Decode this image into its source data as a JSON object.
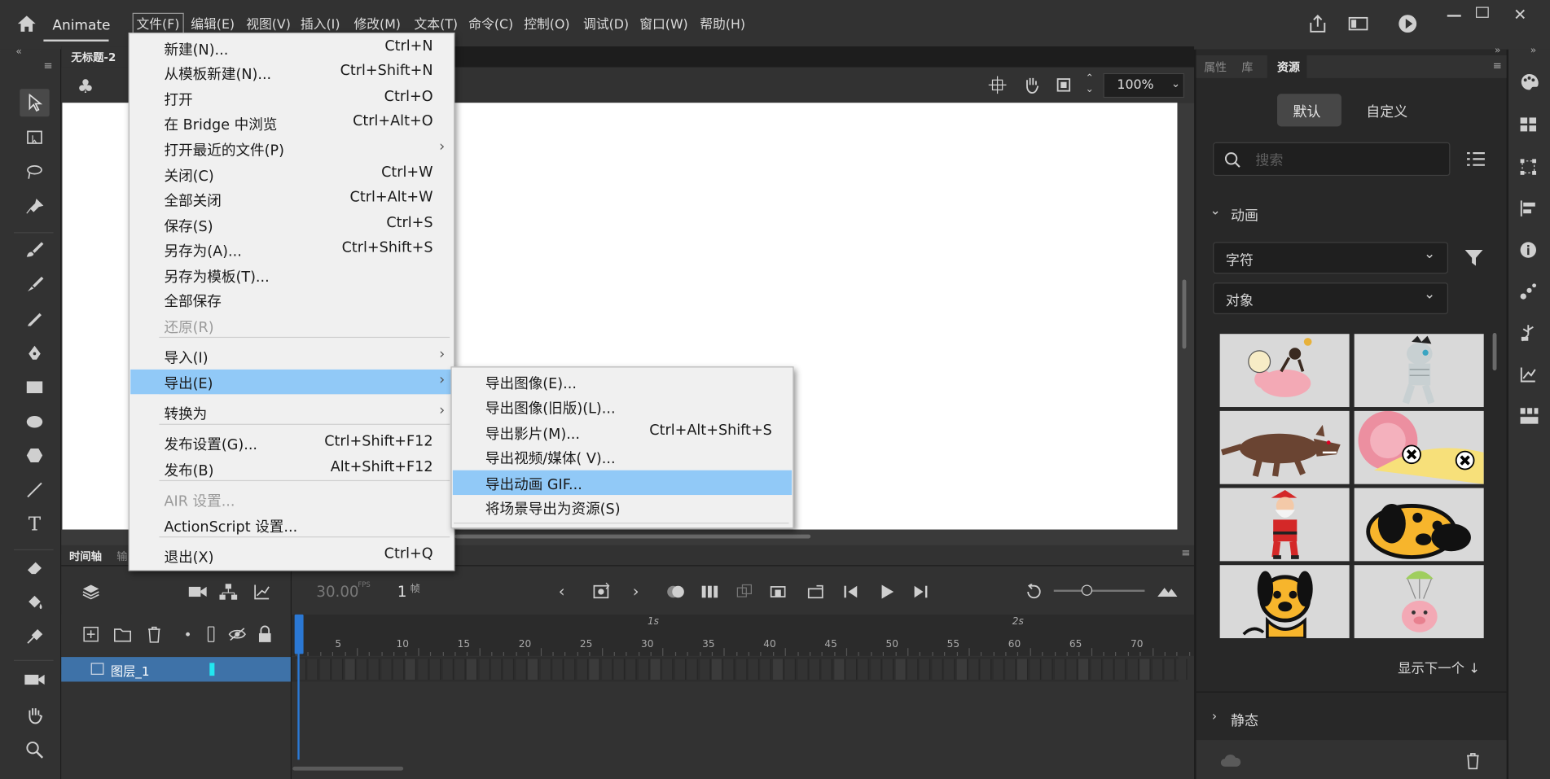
{
  "app": {
    "name": "Animate"
  },
  "menubar": [
    "文件(F)",
    "编辑(E)",
    "视图(V)",
    "插入(I)",
    "修改(M)",
    "文本(T)",
    "命令(C)",
    "控制(O)",
    "调试(D)",
    "窗口(W)",
    "帮助(H)"
  ],
  "document": {
    "tab": "无标题-2",
    "zoom": "100%"
  },
  "file_menu": [
    {
      "label": "新建(N)...",
      "shortcut": "Ctrl+N"
    },
    {
      "label": "从模板新建(N)...",
      "shortcut": "Ctrl+Shift+N"
    },
    {
      "label": "打开",
      "shortcut": "Ctrl+O"
    },
    {
      "label": "在 Bridge 中浏览",
      "shortcut": "Ctrl+Alt+O"
    },
    {
      "label": "打开最近的文件(P)",
      "shortcut": ""
    },
    {
      "label": "关闭(C)",
      "shortcut": "Ctrl+W"
    },
    {
      "label": "全部关闭",
      "shortcut": "Ctrl+Alt+W"
    },
    {
      "label": "保存(S)",
      "shortcut": "Ctrl+S"
    },
    {
      "label": "另存为(A)...",
      "shortcut": "Ctrl+Shift+S"
    },
    {
      "label": "另存为模板(T)...",
      "shortcut": ""
    },
    {
      "label": "全部保存",
      "shortcut": ""
    },
    {
      "label": "还原(R)",
      "shortcut": ""
    },
    {
      "label": "导入(I)",
      "shortcut": ""
    },
    {
      "label": "导出(E)",
      "shortcut": ""
    },
    {
      "label": "转换为",
      "shortcut": ""
    },
    {
      "label": "发布设置(G)...",
      "shortcut": "Ctrl+Shift+F12"
    },
    {
      "label": "发布(B)",
      "shortcut": "Alt+Shift+F12"
    },
    {
      "label": "AIR 设置...",
      "shortcut": ""
    },
    {
      "label": "ActionScript 设置...",
      "shortcut": ""
    },
    {
      "label": "退出(X)",
      "shortcut": "Ctrl+Q"
    }
  ],
  "export_submenu": [
    {
      "label": "导出图像(E)...",
      "shortcut": ""
    },
    {
      "label": "导出图像(旧版)(L)...",
      "shortcut": ""
    },
    {
      "label": "导出影片(M)...",
      "shortcut": "Ctrl+Alt+Shift+S"
    },
    {
      "label": "导出视频/媒体( V)...",
      "shortcut": ""
    },
    {
      "label": "导出动画 GIF...",
      "shortcut": ""
    },
    {
      "label": "将场景导出为资源(S)",
      "shortcut": ""
    }
  ],
  "timeline": {
    "tab_label": "时间轴",
    "tab2_label": "输",
    "fps": "30.00",
    "fps_unit": "FPS",
    "frame": "1",
    "frame_unit": "帧",
    "layer_name": "图层_1",
    "ruler_numbers": [
      "5",
      "10",
      "15",
      "20",
      "25",
      "30",
      "35",
      "40",
      "45",
      "50",
      "55",
      "60",
      "65",
      "70"
    ],
    "time_markers": [
      "1s",
      "2s"
    ]
  },
  "right_panel": {
    "tabs": [
      "属性",
      "库",
      "资源"
    ],
    "seg_buttons": [
      "默认",
      "自定义"
    ],
    "search_placeholder": "搜索",
    "section_animation": "动画",
    "dropdown1": "字符",
    "dropdown2": "对象",
    "show_next": "显示下一个 ↓",
    "section_static": "静态"
  }
}
